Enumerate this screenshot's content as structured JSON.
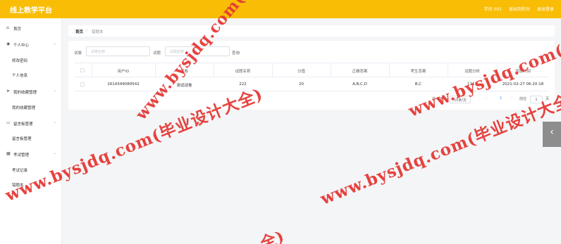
{
  "header": {
    "title": "线上教学平台",
    "links": [
      "学员 001",
      "退出到前台",
      "退出登录"
    ]
  },
  "sidebar": {
    "home": "首页",
    "groups": [
      {
        "label": "个人中心",
        "items": [
          "修改密码",
          "个人信息"
        ]
      },
      {
        "label": "我的收藏管理",
        "items": [
          "我的收藏管理"
        ]
      },
      {
        "label": "留言板管理",
        "items": [
          "留言板管理"
        ]
      },
      {
        "label": "考试管理",
        "items": [
          "考试记录",
          "错题本"
        ]
      }
    ]
  },
  "breadcrumb": {
    "home": "首页",
    "separator": "/",
    "current": "错题本"
  },
  "search": {
    "paper_label": "试卷",
    "paper_placeholder": "试卷名称",
    "question_label": "试题",
    "question_placeholder": "试题名称",
    "query_button": "查询"
  },
  "table": {
    "columns": [
      "用户ID",
      "试卷",
      "试题名称",
      "分值",
      "正确答案",
      "考生答案",
      "试题分析",
      "添加时间"
    ],
    "rows": [
      [
        "1614349089542",
        "测试试卷",
        "222",
        "20",
        "A,B,C,D",
        "B,C",
        "1111",
        "2021-02-27 06:20:18"
      ]
    ]
  },
  "pagination": {
    "total": "共 1 条",
    "page_size": "10条/页",
    "prev": "‹",
    "current": "1",
    "next": "›",
    "goto_label": "前往",
    "goto_value": "1",
    "page_unit": "页"
  },
  "float_tab": {
    "icon": "chevron-left-icon",
    "glyph": "‹"
  },
  "watermarks": [
    "www.bysjdq.com(毕业设计大全)",
    "www.bysjdq.com(毕业设计大全)",
    "www.bysjdq.com(毕业设计大全)",
    "www.bysjdq.com(毕业设计大全)",
    "全)"
  ],
  "colors": {
    "topbar": "#f9bd05",
    "watermark": "#e53935",
    "link": "#409eff"
  }
}
